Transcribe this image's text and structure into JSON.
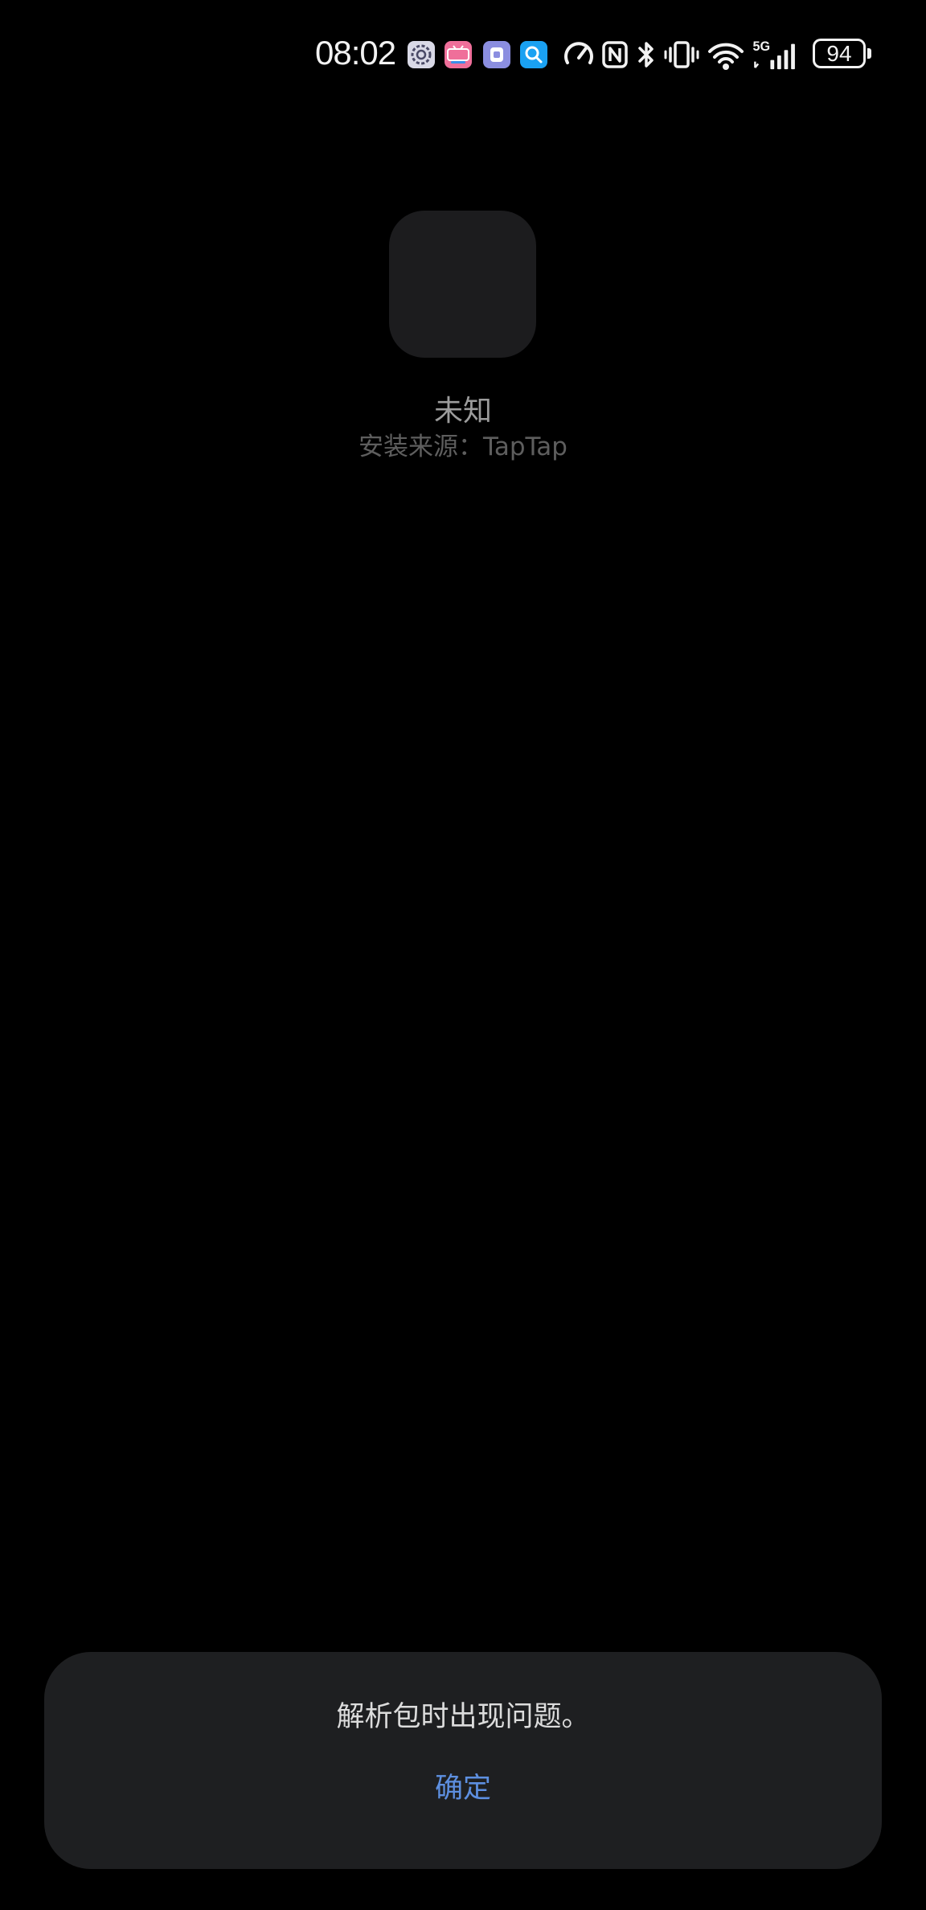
{
  "status_bar": {
    "time": "08:02",
    "battery_level": "94",
    "network_label": "5G",
    "notification_icons": [
      "settings-icon",
      "bilibili-icon",
      "app-icon",
      "search-icon"
    ],
    "system_icons": [
      "speedometer-icon",
      "nfc-icon",
      "bluetooth-icon",
      "vibrate-icon",
      "wifi-icon",
      "cellular-signal-icon",
      "battery-icon"
    ]
  },
  "app_info": {
    "name": "未知",
    "install_source": "安装来源：TapTap"
  },
  "dialog": {
    "message": "解析包时出现问题。",
    "confirm_label": "确定"
  },
  "colors": {
    "background": "#000000",
    "dialog_background": "#1e1f21",
    "accent": "#5d8fe0",
    "icon_placeholder": "#1c1c1e"
  }
}
